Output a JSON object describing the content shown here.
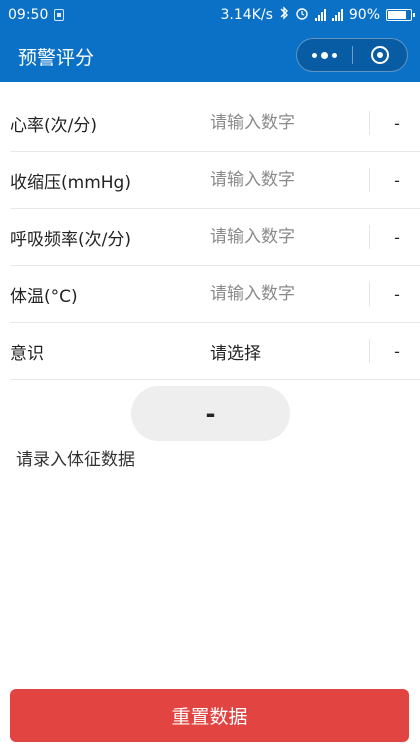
{
  "status_bar": {
    "time": "09:50",
    "speed": "3.14K/s",
    "battery_percent": "90%"
  },
  "header": {
    "title": "预警评分"
  },
  "form": {
    "rows": [
      {
        "label": "心率(次/分)",
        "placeholder": "请输入数字",
        "score": "-"
      },
      {
        "label": "收缩压(mmHg)",
        "placeholder": "请输入数字",
        "score": "-"
      },
      {
        "label": "呼吸频率(次/分)",
        "placeholder": "请输入数字",
        "score": "-"
      },
      {
        "label": "体温(°C)",
        "placeholder": "请输入数字",
        "score": "-"
      }
    ],
    "consciousness": {
      "label": "意识",
      "value": "请选择",
      "score": "-"
    }
  },
  "result": {
    "score": "-",
    "hint": "请录入体征数据"
  },
  "actions": {
    "reset_label": "重置数据"
  },
  "colors": {
    "primary": "#0a71c7",
    "danger": "#e24442",
    "pill_bg": "#eeeeee"
  }
}
